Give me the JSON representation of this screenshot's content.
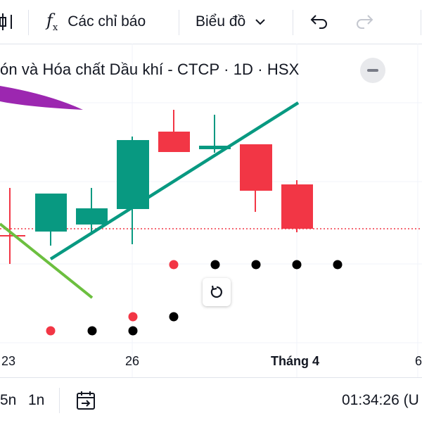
{
  "toolbar": {
    "indicators_label": "Các chỉ báo",
    "chart_type_label": "Biểu đồ"
  },
  "legend": {
    "symbol_text": "ón và Hóa chất Dầu khí - CTCP · 1D · HSX"
  },
  "x_axis": {
    "labels": [
      "23",
      "26",
      "Tháng 4",
      "6"
    ]
  },
  "bottombar": {
    "range_5d": "5n",
    "range_1m": "1n",
    "clock": "01:34:26 (U"
  },
  "colors": {
    "up": "#089981",
    "down": "#f23645",
    "trendline_teal": "#089981",
    "trendline_green": "#6cbf3f",
    "purple": "#9c27b0",
    "dots_black": "#000000",
    "dots_red": "#f23645"
  },
  "icons": {
    "bar_style": "candles-icon",
    "indicators": "fx-icon",
    "chart_type_caret": "chevron-down-icon",
    "undo": "undo-icon",
    "redo": "redo-icon",
    "collapse": "minus-icon",
    "reset": "rotate-icon",
    "date_range": "calendar-arrow-icon"
  }
}
